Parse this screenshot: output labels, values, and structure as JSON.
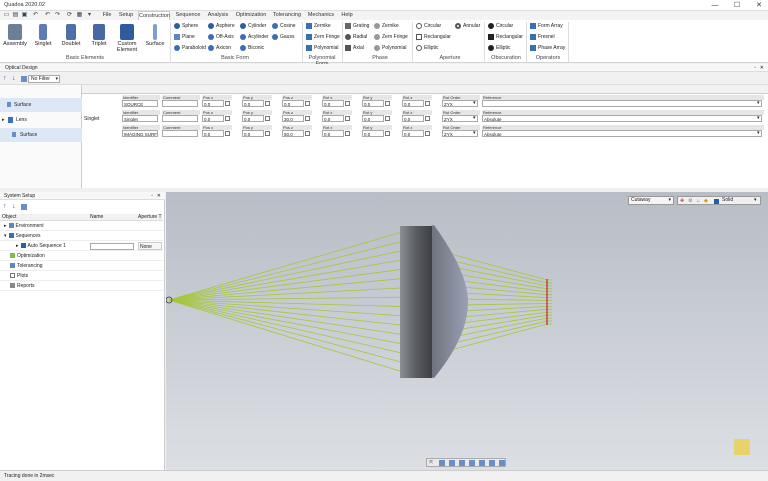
{
  "app": {
    "title": "Quadoa 2020.02"
  },
  "window": {
    "min": "—",
    "max": "☐",
    "close": "✕"
  },
  "tabs": [
    "File",
    "Setup",
    "Construction",
    "Sequence",
    "Analysis",
    "Optimization",
    "Tolerancing",
    "Mechanics",
    "Help"
  ],
  "active_tab": "Construction",
  "basic_elements": {
    "buttons": [
      "Assembly",
      "Singlet",
      "Doublet",
      "Triplet",
      "Custom Element",
      "Surface"
    ],
    "label": "Basic Elements"
  },
  "basic_form": {
    "col1": [
      "Sphere",
      "Plane",
      "Paraboloid"
    ],
    "col2": [
      "Asphere",
      "Off-Axis",
      "Axicon"
    ],
    "col3": [
      "Cylinder",
      "Acylinder",
      "Biconic"
    ],
    "col4": [
      "Cosine",
      "Gauss"
    ],
    "label": "Basic Form"
  },
  "poly_form": {
    "items": [
      "Zernike",
      "Zern Fringe",
      "Polynomial"
    ],
    "label": "Polynomial Form"
  },
  "phase": {
    "col1": [
      "Grating",
      "Radial",
      "Axial"
    ],
    "col2": [
      "Zernike",
      "Zern Fringe",
      "Polynomial"
    ],
    "label": "Phase"
  },
  "aperture": {
    "col1": [
      "Circular",
      "Rectangular",
      "Elliptic"
    ],
    "col2": [
      "Annular"
    ],
    "label": "Aperture"
  },
  "obscuration": {
    "items": [
      "Circular",
      "Rectangular",
      "Elliptic"
    ],
    "label": "Obscuration"
  },
  "operators": {
    "items": [
      "Form Array",
      "Fresnel",
      "Phase Array"
    ],
    "label": "Operators"
  },
  "optical_design": {
    "title": "Optical Design",
    "filter": "No Filter"
  },
  "grid_headers": [
    "Identifier",
    "Comment",
    "Pos x",
    "Pos y",
    "Pos z",
    "Rot x",
    "Rot y",
    "Rot z",
    "Rot Order",
    "Reference"
  ],
  "rows": [
    {
      "label": "Surface",
      "type": "",
      "values": [
        "SOURCE",
        "",
        "0.0",
        "0.0",
        "0.0",
        "0.0",
        "0.0",
        "0.0",
        "ZYX",
        ""
      ]
    },
    {
      "label": "Lens",
      "type": "Singlet",
      "values": [
        "Singlet",
        "",
        "0.0",
        "0.0",
        "30.0",
        "0.0",
        "0.0",
        "0.0",
        "ZYX",
        "Absolute"
      ]
    },
    {
      "label": "Surface",
      "type": "",
      "values": [
        "IMAGING SURFA",
        "",
        "0.0",
        "0.0",
        "50.0",
        "0.0",
        "0.0",
        "0.0",
        "ZYX",
        "Absolute"
      ]
    }
  ],
  "system_setup": {
    "title": "System Setup",
    "cols": [
      "Object",
      "Name",
      "Aperture T"
    ],
    "items": [
      "Environment",
      "Sequences",
      "Auto Sequence 1",
      "Optimization",
      "Tolerancing",
      "Plots",
      "Reports"
    ],
    "aperture_value": "None"
  },
  "view": {
    "mode": "Cutaway",
    "render": "Solid"
  },
  "status": "Tracing done in 2msec"
}
